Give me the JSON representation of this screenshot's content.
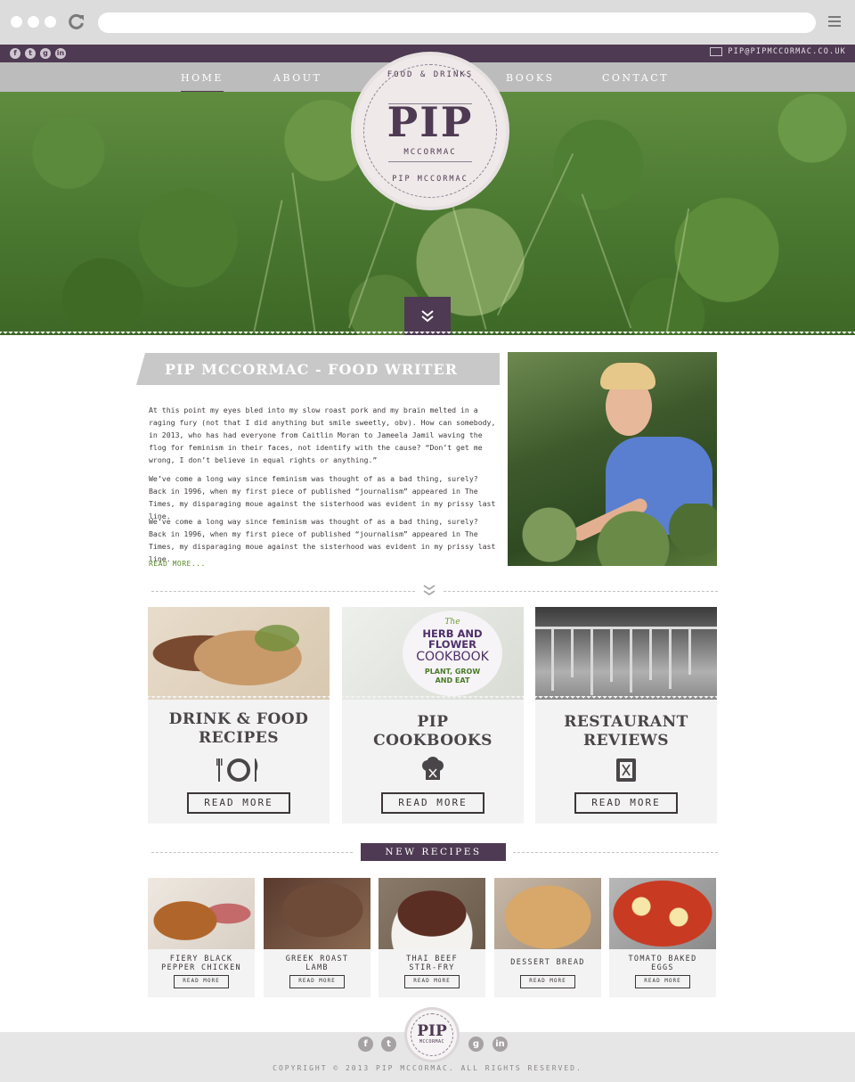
{
  "browser": {
    "icons": [
      "window-dot-icon",
      "reload-icon",
      "menu-icon"
    ]
  },
  "topbar": {
    "social_icons": [
      "facebook-icon",
      "twitter-icon",
      "google-plus-icon",
      "linkedin-icon"
    ],
    "email": "PIP@PIPMCCORMAC.CO.UK"
  },
  "nav": {
    "items": [
      {
        "label": "HOME",
        "active": true
      },
      {
        "label": "ABOUT",
        "active": false
      },
      {
        "label": "BOOKS",
        "active": false
      },
      {
        "label": "CONTACT",
        "active": false
      }
    ]
  },
  "logo": {
    "top_text": "FOOD & DRINKS",
    "main": "PIP",
    "sub": "MCCORMAC",
    "bottom_text": "PIP MCCORMAC"
  },
  "intro": {
    "title": "PIP MCCORMAC - FOOD WRITER",
    "paragraphs": [
      "At this point my eyes bled into my slow roast pork and my brain melted in a raging fury (not that I did anything but smile sweetly, obv). How can somebody, in 2013, who has had everyone from Caitlin Moran to Jameela Jamil waving the flog for feminism in their faces, not identify with the cause? “Don’t get me wrong, I don’t believe in equal rights or anything.”",
      "We’ve come a long way since feminism was thought of as a bad thing, surely? Back in 1996, when my first piece of published “journalism” appeared in The Times, my disparaging moue against the sisterhood was evident in my prissy last line.",
      "We’ve come a long way since feminism was thought of as a bad thing, surely? Back in 1996, when my first piece of published “journalism” appeared in The Times, my disparaging moue against the sisterhood was evident in my prissy last line."
    ],
    "read_more": "READ MORE..."
  },
  "categories": [
    {
      "title_l1": "DRINK & FOOD",
      "title_l2": "RECIPES",
      "icon": "cutlery-plate-icon",
      "button": "READ MORE"
    },
    {
      "title_l1": "PIP",
      "title_l2": "COOKBOOKS",
      "icon": "chef-hat-icon",
      "button": "READ MORE"
    },
    {
      "title_l1": "RESTAURANT",
      "title_l2": "REVIEWS",
      "icon": "menu-book-icon",
      "button": "READ MORE"
    }
  ],
  "cookbook_cover": {
    "line1": "The",
    "line2": "HERB AND FLOWER",
    "line3": "COOKBOOK",
    "line4": "PLANT, GROW",
    "line5": "AND EAT"
  },
  "new_recipes": {
    "label": "NEW RECIPES",
    "items": [
      {
        "l1": "FIERY BLACK",
        "l2": "PEPPER CHICKEN",
        "button": "READ MORE"
      },
      {
        "l1": "GREEK ROAST",
        "l2": "LAMB",
        "button": "READ MORE"
      },
      {
        "l1": "THAI BEEF",
        "l2": "STIR-FRY",
        "button": "READ MORE"
      },
      {
        "l1": "DESSERT BREAD",
        "l2": "",
        "button": "READ MORE"
      },
      {
        "l1": "TOMATO BAKED",
        "l2": "EGGS",
        "button": "READ MORE"
      }
    ]
  },
  "footer": {
    "logo_main": "PIP",
    "logo_sub": "MCCORMAC",
    "social_icons": [
      "facebook-icon",
      "twitter-icon",
      "google-plus-icon",
      "linkedin-icon"
    ],
    "copyright": "COPYRIGHT © 2013 PIP MCCORMAC. ALL RIGHTS RESERVED."
  },
  "colors": {
    "brand_purple": "#4e3a52",
    "nav_gray": "#bdbcbc",
    "card_bg": "#f3f3f3",
    "link_green": "#5a8a2a"
  }
}
